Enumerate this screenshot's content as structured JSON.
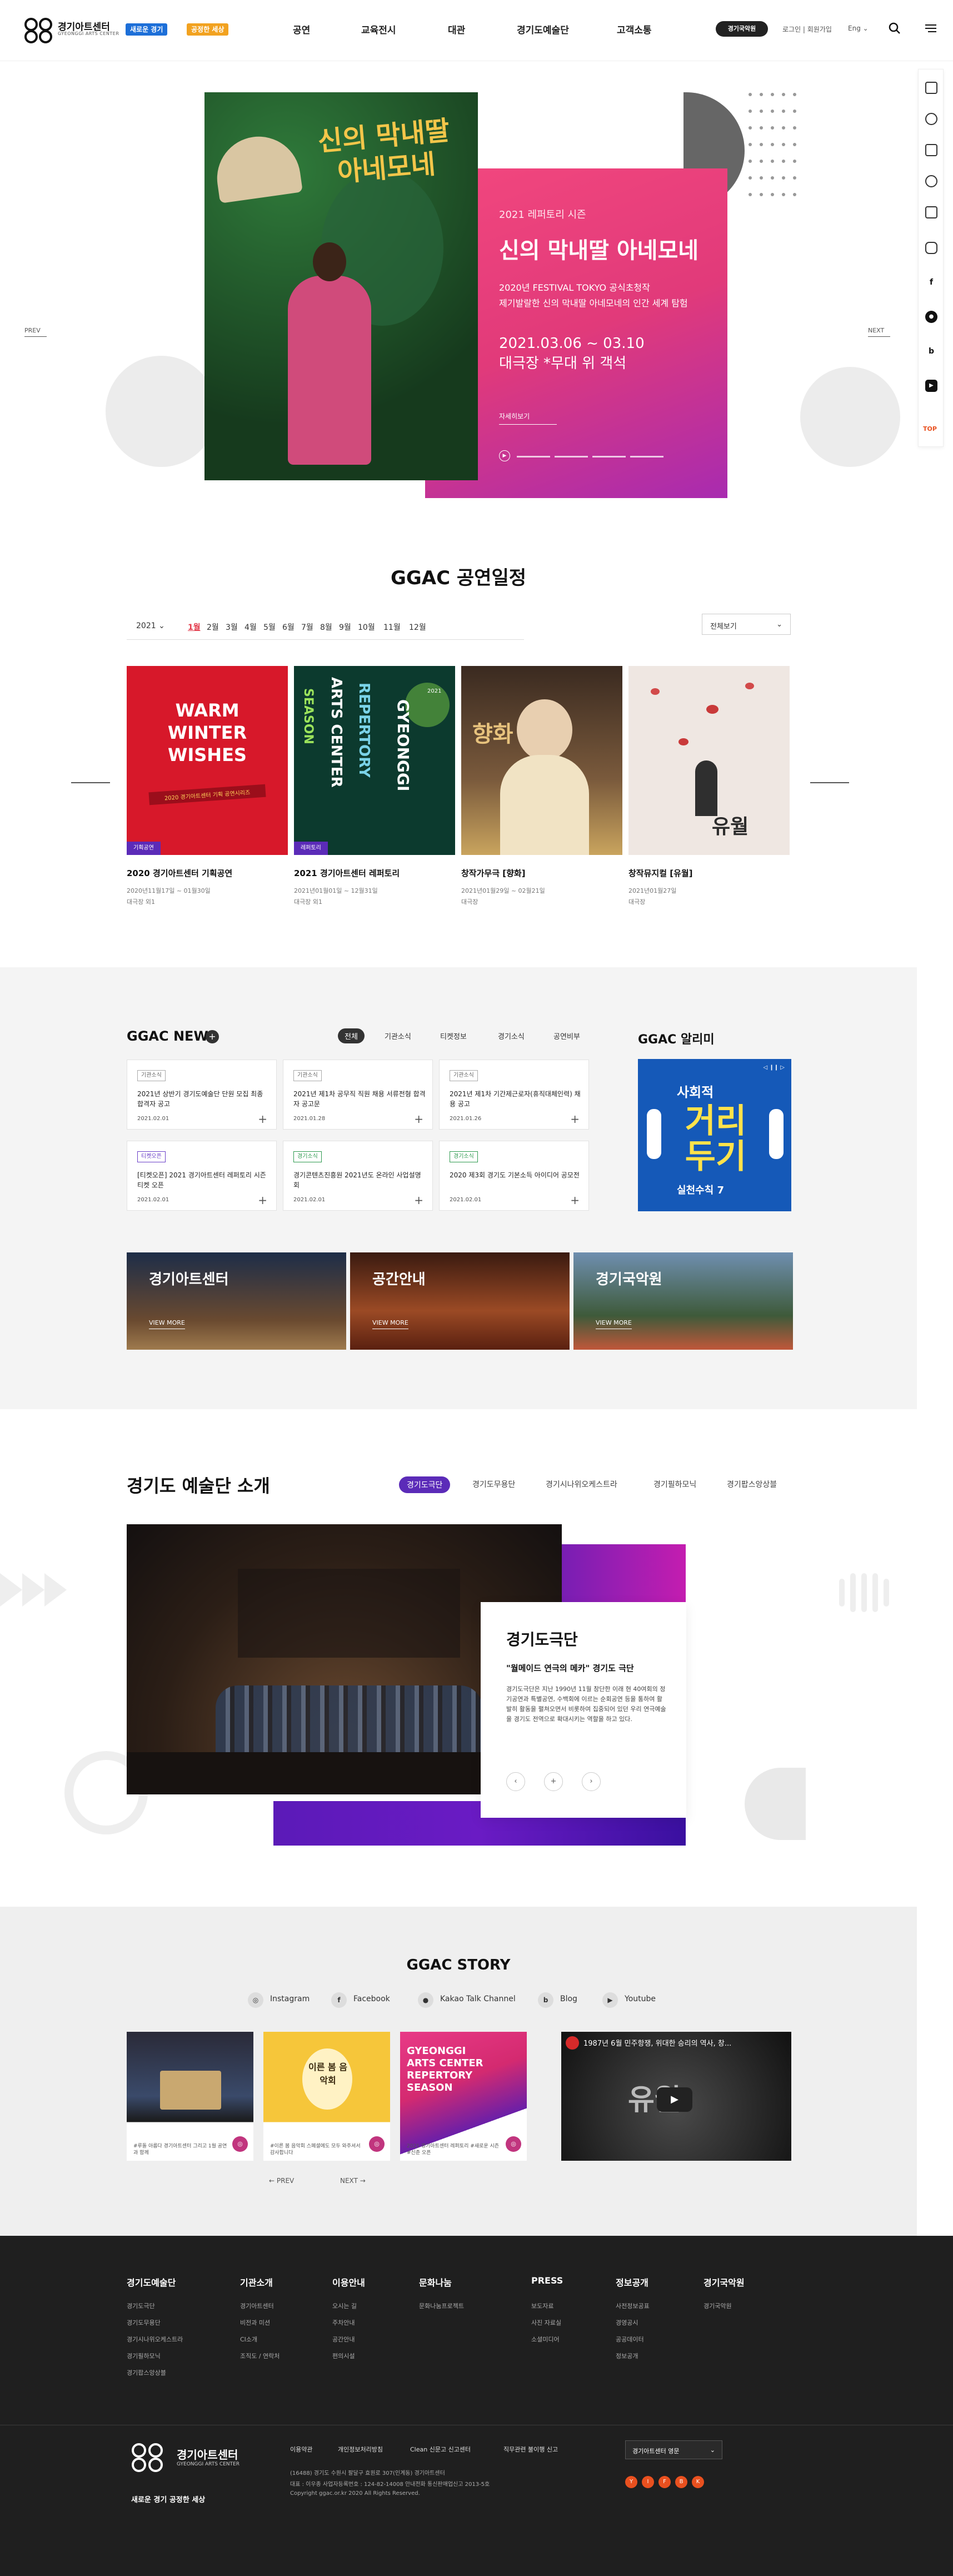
{
  "header": {
    "logo_kor": "경기아트센터",
    "logo_eng": "GYEONGGI ARTS CENTER",
    "slogan_a": "새로운 경기",
    "slogan_b": "공정한 세상",
    "nav": [
      "공연",
      "교육전시",
      "대관",
      "경기도예술단",
      "고객소통"
    ],
    "theater_btn": "경기국악원",
    "login": "로그인 | 회원가입",
    "lang": "Eng"
  },
  "quick": {
    "top": "TOP"
  },
  "hero": {
    "sub": "2021 레퍼토리 시즌",
    "title": "신의 막내딸 아네모네",
    "desc": [
      "2020년 FESTIVAL TOKYO 공식초청작",
      "제기발랄한 신의 막내딸 아네모네의 인간 세계 탐험"
    ],
    "date": "2021.03.06 ~ 03.10",
    "venue": "대극장 *무대 위 객석",
    "more": "자세히보기",
    "prev": "PREV",
    "next": "NEXT",
    "poster_title": [
      "신의 막내딸",
      "아네모네"
    ]
  },
  "schedule": {
    "title": "GGAC 공연일정",
    "year": "2021",
    "months": [
      "1월",
      "2월",
      "3월",
      "4월",
      "5월",
      "6월",
      "7월",
      "8월",
      "9월",
      "10월",
      "11월",
      "12월"
    ],
    "view": "전체보기",
    "cards": [
      {
        "tag": "기획공연",
        "title": "2020 경기아트센터 기획공연",
        "date": "2020년11월17일 ~ 01월30일",
        "place": "대극장 외1",
        "poster": [
          "WARM",
          "WINTER",
          "WISHES",
          "2020 경기아트센터 기획 공연시리즈"
        ]
      },
      {
        "tag": "레퍼토리",
        "title": "2021 경기아트센터 레퍼토리",
        "date": "2021년01월01일 ~ 12월31일",
        "place": "대극장 외1",
        "poster": [
          "GYEONGGI",
          "ARTS CENTER",
          "REPERTORY",
          "SEASON",
          "2021"
        ]
      },
      {
        "tag": "",
        "title": "창작가무극 [향화]",
        "date": "2021년01월29일 ~ 02월21일",
        "place": "대극장",
        "poster": [
          "향화"
        ]
      },
      {
        "tag": "",
        "title": "창작뮤지컬 [유월]",
        "date": "2021년01월27일",
        "place": "대극장",
        "poster": [
          "유월"
        ]
      }
    ]
  },
  "news": {
    "title": "GGAC NEWS",
    "tabs": [
      "전체",
      "기관소식",
      "티켓정보",
      "경기소식",
      "공연비부"
    ],
    "items": [
      {
        "tag": "기관소식",
        "title": "2021년 상반기 경기도예술단 단원 모집 최종 합격자 공고",
        "date": "2021.02.01"
      },
      {
        "tag": "기관소식",
        "title": "2021년 제1차 공무직 직원 채용 서류전형 합격자 공고문",
        "date": "2021.01.28"
      },
      {
        "tag": "기관소식",
        "title": "2021년 제1차 기간제근로자(휴직대체인력) 채용 공고",
        "date": "2021.01.26"
      },
      {
        "tag": "티켓오픈",
        "title": "[티켓오픈] 2021 경기아트센터 레퍼토리 시즌 티켓 오픈",
        "date": "2021.02.01"
      },
      {
        "tag": "경기소식",
        "title": "경기콘텐츠진흥원 2021년도 온라인 사업설명회",
        "date": "2021.02.01"
      },
      {
        "tag": "경기소식",
        "title": "2020 제3회 경기도 기본소득 아이디어 공모전",
        "date": "2021.02.01"
      }
    ],
    "notice_title": "GGAC 알리미",
    "notice_img": [
      "사회적",
      "거리",
      "두기",
      "실천수칙 7"
    ]
  },
  "venues": [
    {
      "title": "경기아트센터",
      "more": "VIEW MORE"
    },
    {
      "title": "공간안내",
      "more": "VIEW MORE"
    },
    {
      "title": "경기국악원",
      "more": "VIEW MORE"
    }
  ],
  "art": {
    "title": "경기도 예술단 소개",
    "tabs": [
      "경기도극단",
      "경기도무용단",
      "경기시나위오케스트라",
      "경기필하모닉",
      "경기팝스앙상블"
    ],
    "card_title": "경기도극단",
    "card_sub": "\"월메이드 연극의 메카\" 경기도 극단",
    "card_desc": "경기도극단은 지난 1990년 11월 창단한 이래 현 40여회의 정기공연과 특별공연, 수백회에 이르는 순회공연 등을 통하여 활발히 활동을 펼쳐오면서 비롯하여 집중되어 있던 우리 연극예술을 경기도 전역으로 확대시키는 역할을 하고 있다."
  },
  "story": {
    "title": "GGAC STORY",
    "sns": [
      "Instagram",
      "Facebook",
      "Kakao Talk Channel",
      "Blog",
      "Youtube"
    ],
    "cards": [
      {
        "caption": "#루돌 아름다 경기아트센터 그리고 1월 공연과 함께"
      },
      {
        "caption": "#이른 봄 음악회 스페셜에도 모두 와주셔서 감사합니다"
      },
      {
        "caption": "2021 경기아트센터 레퍼토리 #새로운 시즌 #신춘 오픈"
      }
    ],
    "video_title": "1987년 6월 민주항쟁, 위대한 승리의 역사, 창...",
    "prev": "PREV",
    "next": "NEXT"
  },
  "footer": {
    "cols": [
      {
        "title": "경기도예술단",
        "items": [
          "경기도극단",
          "경기도무용단",
          "경기시나위오케스트라",
          "경기필하모닉",
          "경기팝스앙상블"
        ]
      },
      {
        "title": "기관소개",
        "items": [
          "경기아트센터",
          "비전과 미션",
          "CI소개",
          "조직도 / 연락처"
        ]
      },
      {
        "title": "이용안내",
        "items": [
          "오시는 길",
          "주차안내",
          "공간안내",
          "편의시설"
        ]
      },
      {
        "title": "문화나눔",
        "items": [
          "문화나눔프로젝트"
        ]
      },
      {
        "title": "PRESS",
        "items": [
          "보도자료",
          "사진 자료실",
          "소셜미디어"
        ]
      },
      {
        "title": "정보공개",
        "items": [
          "사전정보공표",
          "경영공시",
          "공공데이터",
          "정보공개"
        ]
      },
      {
        "title": "경기국악원",
        "items": [
          "경기국악원"
        ]
      }
    ],
    "name": "경기아트센터",
    "eng": "GYEONGGI ARTS CENTER",
    "slogan": "새로운 경기 공정한 세상",
    "links": [
      "이용약관",
      "개인정보처리방침",
      "Clean 신문고 신고센터",
      "직무관련 불이행 신고"
    ],
    "addr": [
      "(16488) 경기도 수원시 팔달구 효원로 307(인계동) 경기아트센터",
      "대표 : 이우종   사업자등록번호 : 124-82-14008   안내전화 통신판매업신고 2013-5호",
      "Copyright ggac.or.kr 2020 All Rights Reserved."
    ],
    "family": "경기아트센터 영문",
    "sns": [
      "Y",
      "I",
      "F",
      "B",
      "K"
    ]
  }
}
